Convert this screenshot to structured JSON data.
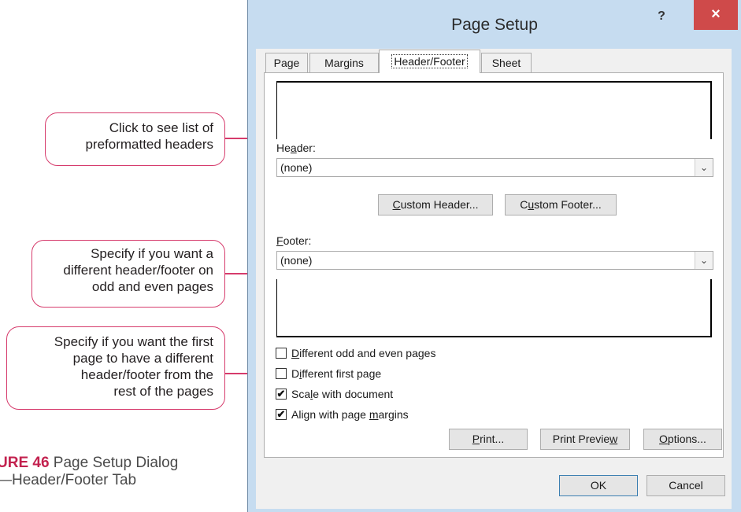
{
  "callouts": {
    "preformatted": "Click to see list of\npreformatted headers",
    "odd_even": "Specify if you want a\ndifferent header/footer on\nodd and even pages",
    "first_page": "Specify if you want the first\npage to have a different\nheader/footer from the\nrest of the pages"
  },
  "caption": {
    "number": "URE 46",
    "line1": " Page Setup Dialog",
    "line2": "—Header/Footer Tab"
  },
  "dialog": {
    "title": "Page Setup",
    "help_label": "?",
    "close_label": "×",
    "tabs": [
      {
        "label": "Page"
      },
      {
        "label": "Margins"
      },
      {
        "label": "Header/Footer"
      },
      {
        "label": "Sheet"
      }
    ],
    "active_tab": "Header/Footer",
    "header": {
      "label_pre": "He",
      "label_key": "a",
      "label_post": "der:",
      "value": "(none)"
    },
    "custom_header": {
      "key": "C",
      "rest": "ustom Header..."
    },
    "custom_footer": {
      "pre": "C",
      "key": "u",
      "rest": "stom Footer..."
    },
    "footer": {
      "label_key": "F",
      "label_post": "ooter:",
      "value": "(none)"
    },
    "options": [
      {
        "key": "D",
        "rest_pre": "",
        "rest": "ifferent odd and even pages",
        "checked": false
      },
      {
        "key": "i",
        "rest_pre": "D",
        "rest": "fferent first page",
        "checked": false
      },
      {
        "key": "l",
        "rest_pre": "Sca",
        "rest": "e with document",
        "checked": true
      },
      {
        "key": "m",
        "rest_pre": "Align with page ",
        "rest": "argins",
        "checked": true
      }
    ],
    "check_mark": "✔",
    "buttons": {
      "print": {
        "key": "P",
        "rest": "rint..."
      },
      "print_preview": {
        "pre": "Print Previe",
        "key": "w"
      },
      "options": {
        "key": "O",
        "rest": "ptions..."
      },
      "ok": "OK",
      "cancel": "Cancel"
    },
    "dropdown_arrow": "⌄"
  }
}
